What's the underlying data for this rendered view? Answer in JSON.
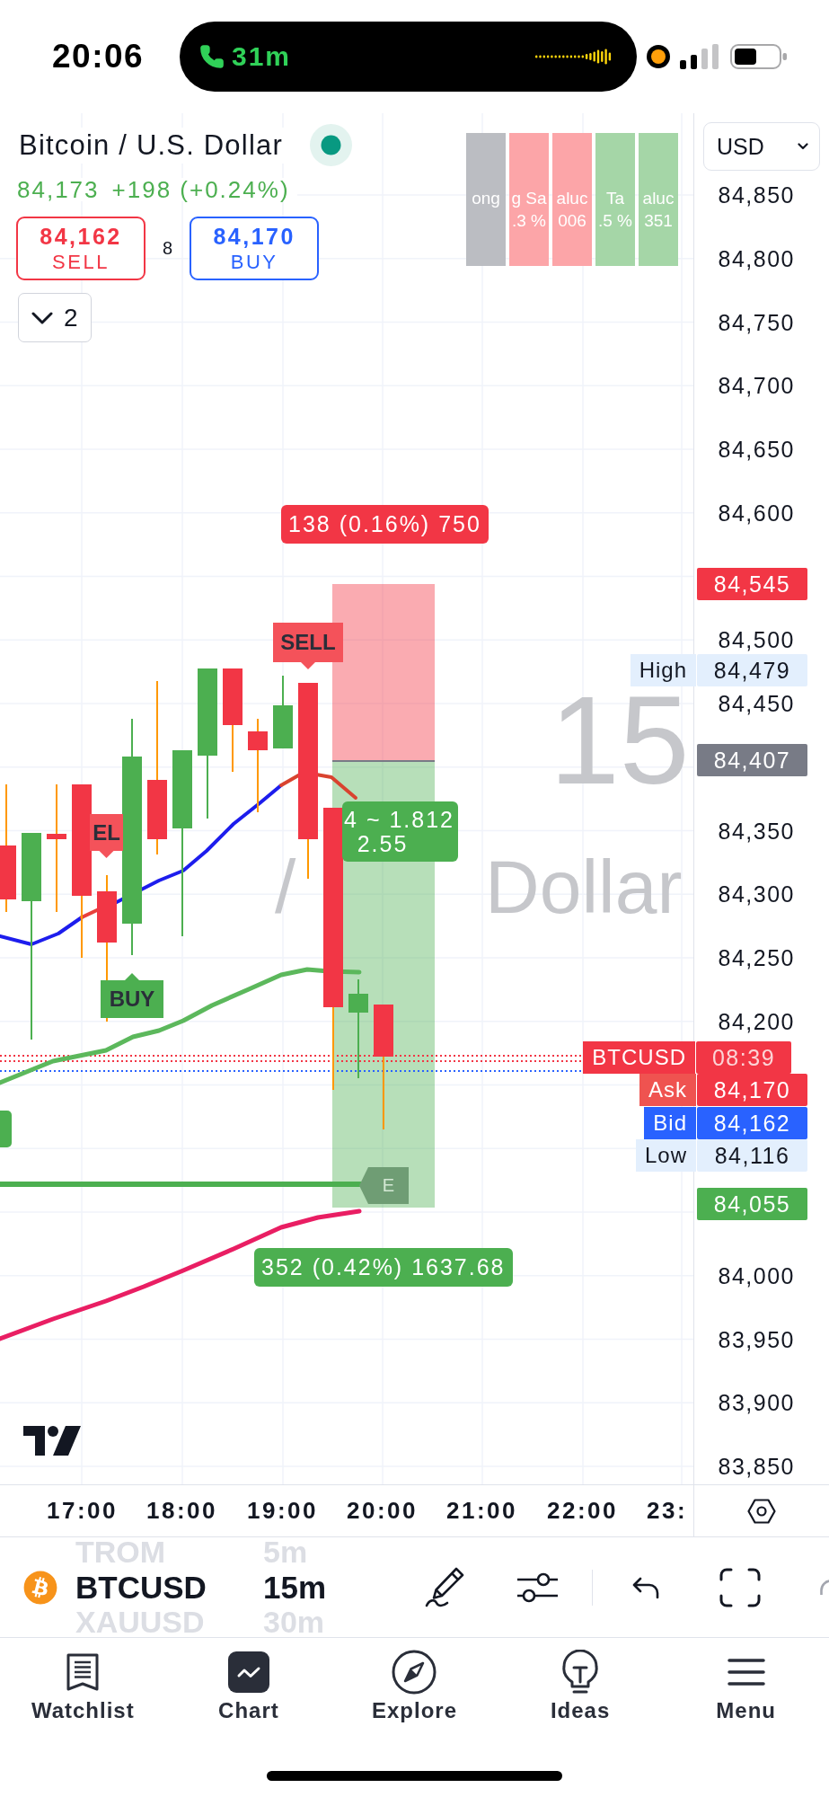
{
  "status_bar": {
    "time": "20:06",
    "call_duration": "31m"
  },
  "legend": {
    "title": "Bitcoin / U.S. Dollar",
    "market_open": true,
    "last_price": "84,173",
    "change": "+198 (+0.24%)",
    "sell": {
      "price": "84,162",
      "label": "SELL"
    },
    "spread": "8",
    "buy": {
      "price": "84,170",
      "label": "BUY"
    },
    "indicators": {
      "count": "2",
      "expanded": false
    }
  },
  "info_table": {
    "cells": [
      {
        "color": "#bbbdc2",
        "lines": [
          "ong"
        ]
      },
      {
        "color": "#fca5a8",
        "lines": [
          "g Sa",
          ".3 %"
        ]
      },
      {
        "color": "#fca5a8",
        "lines": [
          "aluc",
          "006"
        ]
      },
      {
        "color": "#a5d6a7",
        "lines": [
          "Ta",
          ".5 %"
        ]
      },
      {
        "color": "#a5d6a7",
        "lines": [
          "aluc",
          "351"
        ]
      }
    ]
  },
  "watermark": {
    "symbol_part": "15",
    "description_parts": [
      "/",
      "Dollar"
    ]
  },
  "position": {
    "risk_label": "138 (0.16%) 750",
    "ratio_lines": [
      "4 ~ 1.812",
      "2.55"
    ],
    "reward_label": "352 (0.42%) 1637.68",
    "exit_tag": "E"
  },
  "signals": [
    {
      "kind": "sell",
      "text": "SELL"
    },
    {
      "kind": "sell",
      "text": "EL"
    },
    {
      "kind": "buy",
      "text": "BUY"
    },
    {
      "kind": "buy"
    }
  ],
  "price_axis": {
    "currency": "USD",
    "labels": [
      "84,850",
      "84,800",
      "84,750",
      "84,700",
      "84,650",
      "84,600",
      "84,500",
      "84,450",
      "84,350",
      "84,300",
      "84,250",
      "84,200",
      "84,000",
      "83,950",
      "83,900",
      "83,850"
    ]
  },
  "price_tags": [
    {
      "kind": "stop",
      "value": "84,545"
    },
    {
      "kind": "high",
      "label": "High",
      "value": "84,479"
    },
    {
      "kind": "entry",
      "value": "84,407"
    },
    {
      "kind": "symbol",
      "label": "BTCUSD",
      "value": "08:39"
    },
    {
      "kind": "ask",
      "label": "Ask",
      "value": "84,170"
    },
    {
      "kind": "bid",
      "label": "Bid",
      "value": "84,162"
    },
    {
      "kind": "low",
      "label": "Low",
      "value": "84,116"
    },
    {
      "kind": "target",
      "value": "84,055"
    }
  ],
  "time_axis": {
    "labels": [
      "17:00",
      "18:00",
      "19:00",
      "20:00",
      "21:00",
      "22:00",
      "23:"
    ]
  },
  "toolbar": {
    "previous_symbol": "TROM",
    "symbol": "BTCUSD",
    "next_symbol": "XAUUSD",
    "previous_interval": "5m",
    "interval": "15m",
    "next_interval": "30m"
  },
  "nav": [
    {
      "kind": "watchlist",
      "label": "Watchlist",
      "selected": false
    },
    {
      "kind": "chart",
      "label": "Chart",
      "selected": true
    },
    {
      "kind": "explore",
      "label": "Explore",
      "selected": false
    },
    {
      "kind": "ideas",
      "label": "Ideas",
      "selected": false
    },
    {
      "kind": "menu",
      "label": "Menu",
      "selected": false
    }
  ]
}
